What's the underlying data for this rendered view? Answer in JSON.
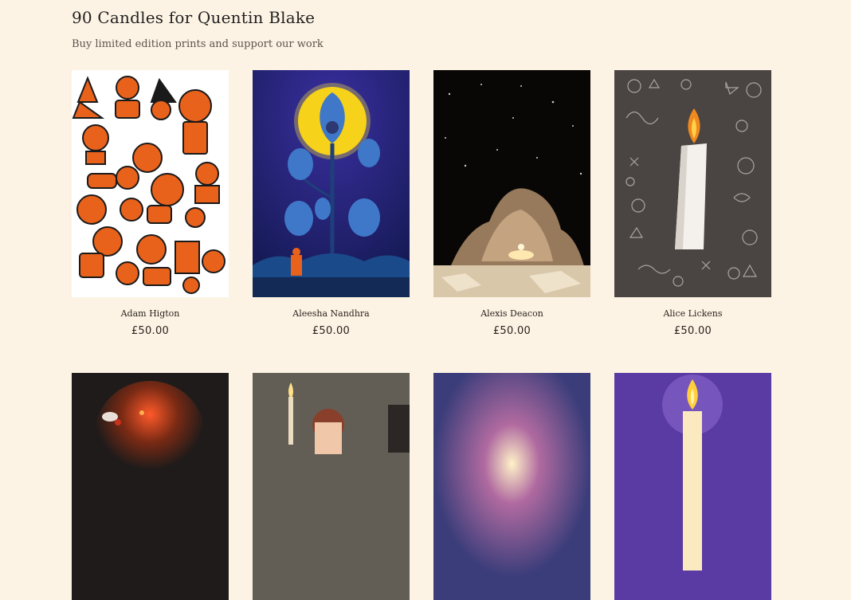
{
  "header": {
    "title": "90 Candles for Quentin Blake",
    "subtitle": "Buy limited edition prints and support our work"
  },
  "products": [
    {
      "artist": "Adam Higton",
      "price": "£50.00",
      "art": "orange-characters-illustration"
    },
    {
      "artist": "Aleesha Nandhra",
      "price": "£50.00",
      "art": "moon-owl-tree-illustration"
    },
    {
      "artist": "Alexis Deacon",
      "price": "£50.00",
      "art": "candle-night-sky-illustration"
    },
    {
      "artist": "Alice Lickens",
      "price": "£50.00",
      "art": "white-candle-doodles-illustration"
    },
    {
      "art": "firefly-glow-illustration"
    },
    {
      "art": "candle-reader-illustration"
    },
    {
      "art": "blue-glow-painting"
    },
    {
      "art": "purple-candle-illustration"
    }
  ],
  "colors": {
    "background": "#fdf3e4",
    "orange": "#e8621c",
    "night_blue": "#1c1f6b",
    "moon_yellow": "#f6d21a",
    "purple": "#5a3aa3"
  }
}
